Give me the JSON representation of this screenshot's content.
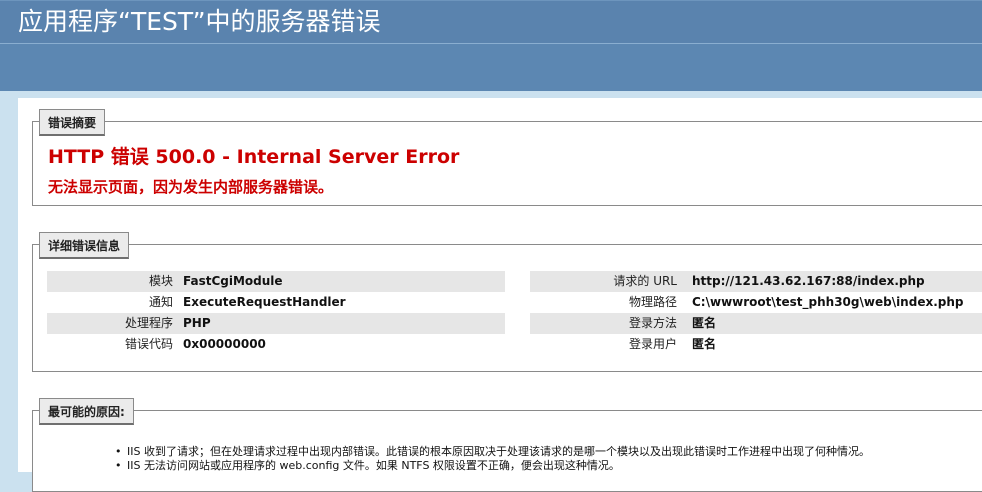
{
  "header": {
    "title": "应用程序“TEST”中的服务器错误"
  },
  "summary": {
    "legend": "错误摘要",
    "title": "HTTP 错误 500.0 - Internal Server Error",
    "description": "无法显示页面，因为发生内部服务器错误。"
  },
  "details": {
    "legend": "详细错误信息",
    "left": [
      {
        "label": "模块",
        "value": "FastCgiModule"
      },
      {
        "label": "通知",
        "value": "ExecuteRequestHandler"
      },
      {
        "label": "处理程序",
        "value": "PHP"
      },
      {
        "label": "错误代码",
        "value": "0x00000000"
      }
    ],
    "right": [
      {
        "label": "请求的 URL",
        "value": "http://121.43.62.167:88/index.php"
      },
      {
        "label": "物理路径",
        "value": "C:\\wwwroot\\test_phh30g\\web\\index.php"
      },
      {
        "label": "登录方法",
        "value": "匿名"
      },
      {
        "label": "登录用户",
        "value": "匿名"
      }
    ]
  },
  "causes": {
    "legend": "最可能的原因:",
    "items": [
      "IIS 收到了请求；但在处理请求过程中出现内部错误。此错误的根本原因取决于处理该请求的是哪一个模块以及出现此错误时工作进程中出现了何种情况。",
      "IIS 无法访问网站或应用程序的 web.config 文件。如果 NTFS 权限设置不正确，便会出现这种情况。"
    ]
  }
}
